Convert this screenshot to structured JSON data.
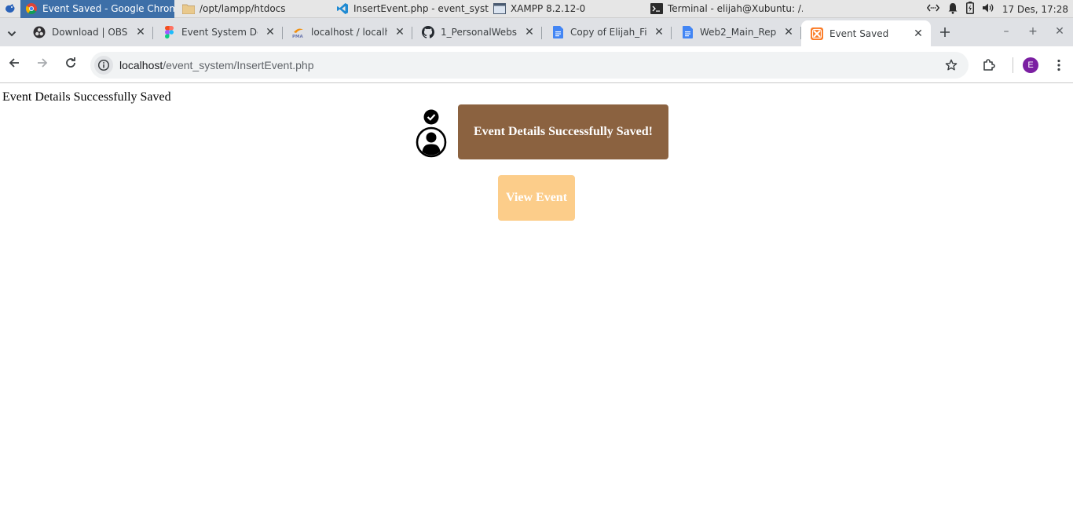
{
  "panel": {
    "tasks": [
      {
        "label": "Event Saved - Google Chrome",
        "icon": "chrome-icon",
        "active": true
      },
      {
        "label": "/opt/lampp/htdocs",
        "icon": "folder-icon"
      },
      {
        "label": "InsertEvent.php - event_syst...",
        "icon": "vscode-icon"
      },
      {
        "label": "XAMPP 8.2.12-0",
        "icon": "window-icon"
      },
      {
        "label": "Terminal - elijah@Xubuntu: /...",
        "icon": "terminal-icon"
      }
    ],
    "clock": "17 Des, 17:28"
  },
  "tabs": [
    {
      "label": "Download | OBS",
      "icon": "obs-icon"
    },
    {
      "label": "Event System De",
      "icon": "figma-icon"
    },
    {
      "label": "localhost / localh",
      "icon": "phpmyadmin-icon"
    },
    {
      "label": "1_PersonalWebs",
      "icon": "github-icon"
    },
    {
      "label": "Copy of Elijah_Fi",
      "icon": "google-docs-icon"
    },
    {
      "label": "Web2_Main_Rep",
      "icon": "google-docs-icon"
    },
    {
      "label": "Event Saved",
      "icon": "xampp-icon",
      "active": true
    }
  ],
  "omnibox": {
    "host": "localhost",
    "path": "/event_system/InsertEvent.php"
  },
  "profile_initial": "E",
  "page": {
    "status_text": "Event Details Successfully Saved",
    "banner_text": "Event Details Successfully Saved!",
    "view_button": "View Event"
  },
  "colors": {
    "banner": "#8b6240",
    "view_button": "#fccd8a",
    "profile": "#7b1fa2"
  }
}
